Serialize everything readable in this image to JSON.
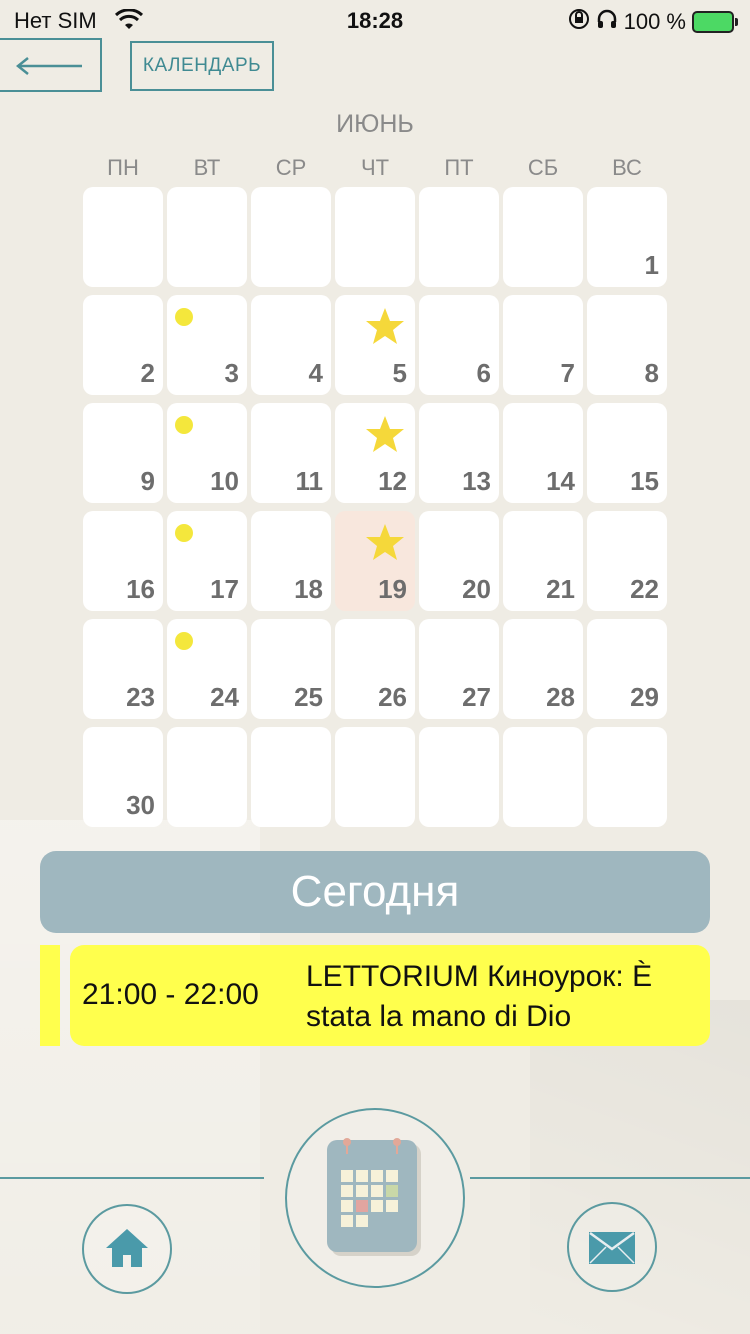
{
  "status_bar": {
    "carrier": "Нет SIM",
    "time": "18:28",
    "battery": "100 %"
  },
  "header": {
    "back_icon": "arrow-left-icon",
    "calendar_label": "КАЛЕНДАРЬ"
  },
  "calendar": {
    "month": "ИЮНЬ",
    "weekdays": [
      "ПН",
      "ВТ",
      "СР",
      "ЧТ",
      "ПТ",
      "СБ",
      "ВС"
    ],
    "today": "19",
    "rows": [
      [
        {
          "d": ""
        },
        {
          "d": ""
        },
        {
          "d": ""
        },
        {
          "d": ""
        },
        {
          "d": ""
        },
        {
          "d": ""
        },
        {
          "d": "1"
        }
      ],
      [
        {
          "d": "2"
        },
        {
          "d": "3",
          "m": "dot"
        },
        {
          "d": "4"
        },
        {
          "d": "5",
          "m": "star"
        },
        {
          "d": "6"
        },
        {
          "d": "7"
        },
        {
          "d": "8"
        }
      ],
      [
        {
          "d": "9"
        },
        {
          "d": "10",
          "m": "dot"
        },
        {
          "d": "11"
        },
        {
          "d": "12",
          "m": "star"
        },
        {
          "d": "13"
        },
        {
          "d": "14"
        },
        {
          "d": "15"
        }
      ],
      [
        {
          "d": "16"
        },
        {
          "d": "17",
          "m": "dot"
        },
        {
          "d": "18"
        },
        {
          "d": "19",
          "m": "star"
        },
        {
          "d": "20"
        },
        {
          "d": "21"
        },
        {
          "d": "22"
        }
      ],
      [
        {
          "d": "23"
        },
        {
          "d": "24",
          "m": "dot"
        },
        {
          "d": "25"
        },
        {
          "d": "26"
        },
        {
          "d": "27"
        },
        {
          "d": "28"
        },
        {
          "d": "29"
        }
      ],
      [
        {
          "d": "30"
        },
        {
          "d": ""
        },
        {
          "d": ""
        },
        {
          "d": ""
        },
        {
          "d": ""
        },
        {
          "d": ""
        },
        {
          "d": ""
        }
      ]
    ]
  },
  "today_section": {
    "label": "Сегодня"
  },
  "event": {
    "time": "21:00 - 22:00",
    "title": "LETTORIUM Киноурок: È stata la mano di Dio",
    "color": "#ffff4d"
  },
  "bottom_nav": {
    "home_icon": "home-icon",
    "calendar_icon": "calendar-icon",
    "mail_icon": "mail-icon"
  }
}
